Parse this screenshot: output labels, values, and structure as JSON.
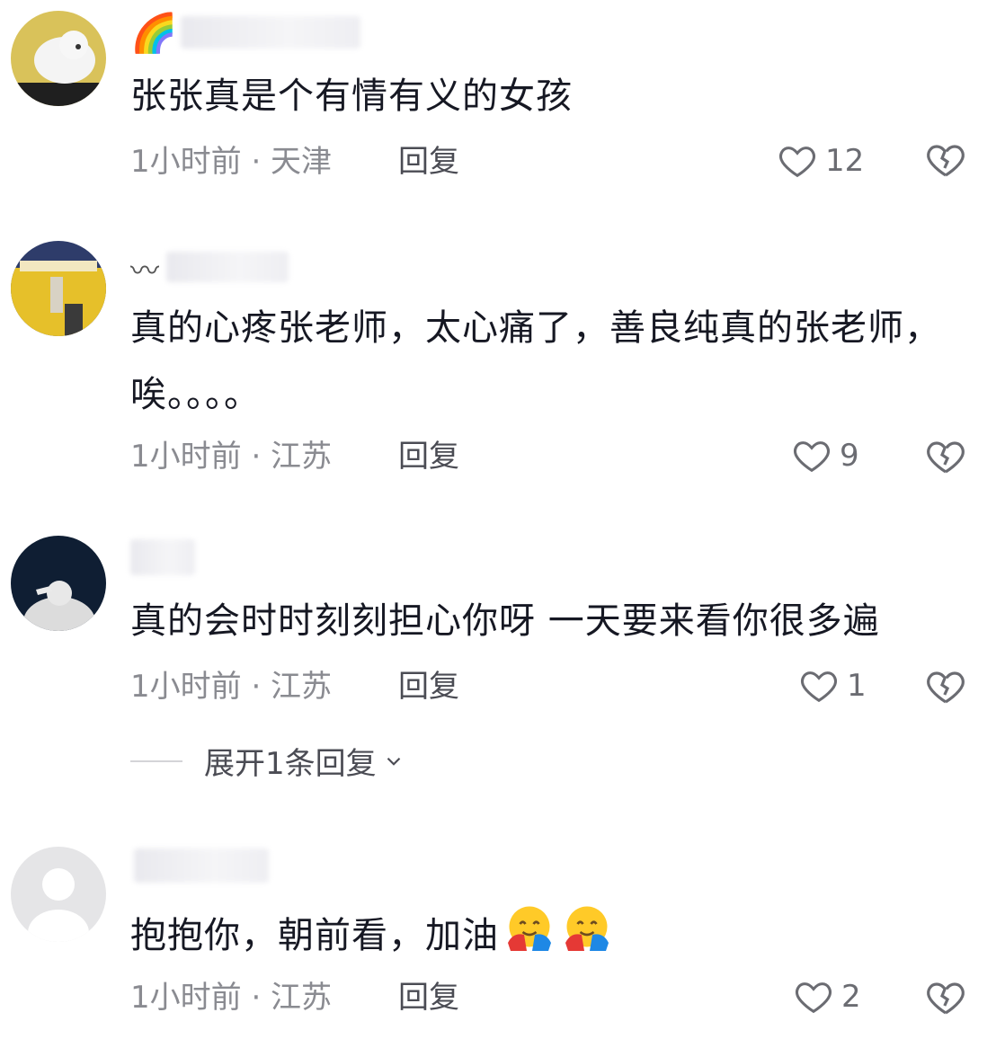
{
  "comments": [
    {
      "username_prefix": "🌈",
      "text": "张张真是个有情有义的女孩",
      "time_location": "1小时前 · 天津",
      "reply_label": "回复",
      "likes": "12"
    },
    {
      "username_prefix": "〰",
      "text": "真的心疼张老师，太心痛了，善良纯真的张老师，唉。。。。",
      "time_location": "1小时前 · 江苏",
      "reply_label": "回复",
      "likes": "9"
    },
    {
      "username_prefix": "",
      "text": "真的会时时刻刻担心你呀 一天要来看你很多遍",
      "time_location": "1小时前 · 江苏",
      "reply_label": "回复",
      "likes": "1",
      "expand_label": "展开1条回复"
    },
    {
      "username_prefix": "",
      "text": "抱抱你，朝前看，加油",
      "time_location": "1小时前 · 江苏",
      "reply_label": "回复",
      "likes": "2",
      "emojis": [
        "hugging-face-emoji",
        "hugging-face-emoji"
      ]
    }
  ],
  "colors": {
    "text": "#161823",
    "meta": "#8a8b91",
    "icon": "#6b6c72"
  }
}
